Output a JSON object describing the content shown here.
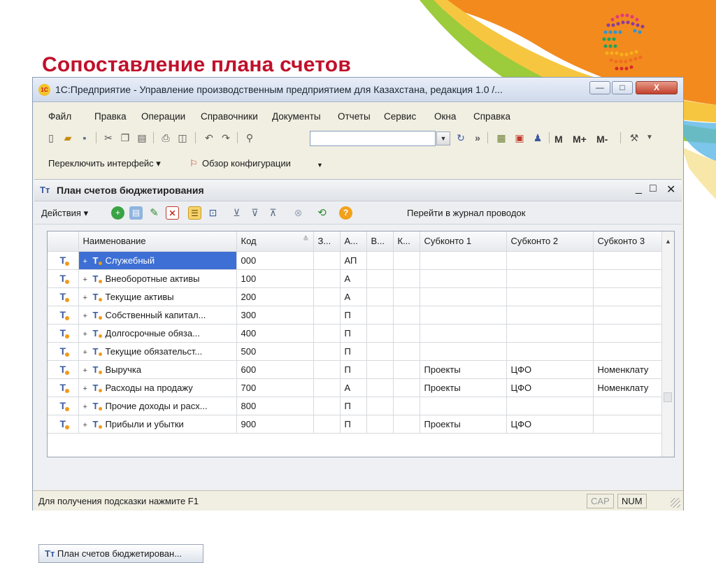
{
  "slide": {
    "title": "Сопоставление плана счетов",
    "accent_color": "#c0102a",
    "logo_icon": "dotted-c-logo-icon"
  },
  "window": {
    "title": "1С:Предприятие - Управление производственным предприятием для Казахстана, редакция 1.0 /...",
    "controls": {
      "minimize": "—",
      "maximize": "□",
      "close": "X"
    }
  },
  "menu": [
    "Файл",
    "Правка",
    "Операции",
    "Справочники",
    "Документы",
    "Отчеты",
    "Сервис",
    "Окна",
    "Справка"
  ],
  "toolbar": {
    "search_value": "",
    "calc_buttons": {
      "m": "M",
      "m_plus": "M+",
      "m_minus": "M-"
    },
    "more": "»"
  },
  "toolbar2": {
    "switch_interface": "Переключить интерфейс ▾",
    "config_overview": "Обзор конфигурации"
  },
  "document": {
    "title": "План счетов бюджетирования",
    "actions_label": "Действия ▾",
    "journal_link": "Перейти в журнал проводок"
  },
  "table": {
    "columns": [
      "",
      "Наименование",
      "Код",
      "З...",
      "А...",
      "В...",
      "К...",
      "Субконто 1",
      "Субконто 2",
      "Субконто 3"
    ],
    "rows": [
      {
        "name": "Служебный",
        "code": "000",
        "z": "",
        "a": "АП",
        "v": "",
        "k": "",
        "s1": "",
        "s2": "",
        "s3": ""
      },
      {
        "name": "Внеоборотные активы",
        "code": "100",
        "z": "",
        "a": "А",
        "v": "",
        "k": "",
        "s1": "",
        "s2": "",
        "s3": ""
      },
      {
        "name": "Текущие активы",
        "code": "200",
        "z": "",
        "a": "А",
        "v": "",
        "k": "",
        "s1": "",
        "s2": "",
        "s3": ""
      },
      {
        "name": "Собственный капитал...",
        "code": "300",
        "z": "",
        "a": "П",
        "v": "",
        "k": "",
        "s1": "",
        "s2": "",
        "s3": ""
      },
      {
        "name": "Долгосрочные обяза...",
        "code": "400",
        "z": "",
        "a": "П",
        "v": "",
        "k": "",
        "s1": "",
        "s2": "",
        "s3": ""
      },
      {
        "name": "Текущие обязательст...",
        "code": "500",
        "z": "",
        "a": "П",
        "v": "",
        "k": "",
        "s1": "",
        "s2": "",
        "s3": ""
      },
      {
        "name": "Выручка",
        "code": "600",
        "z": "",
        "a": "П",
        "v": "",
        "k": "",
        "s1": "Проекты",
        "s2": "ЦФО",
        "s3": "Номенклату"
      },
      {
        "name": "Расходы на продажу",
        "code": "700",
        "z": "",
        "a": "А",
        "v": "",
        "k": "",
        "s1": "Проекты",
        "s2": "ЦФО",
        "s3": "Номенклату"
      },
      {
        "name": "Прочие доходы и расх...",
        "code": "800",
        "z": "",
        "a": "П",
        "v": "",
        "k": "",
        "s1": "",
        "s2": "",
        "s3": ""
      },
      {
        "name": "Прибыли и убытки",
        "code": "900",
        "z": "",
        "a": "П",
        "v": "",
        "k": "",
        "s1": "Проекты",
        "s2": "ЦФО",
        "s3": ""
      }
    ],
    "selected_row": 0
  },
  "taskbar": {
    "tab_label": "План счетов бюджетирован..."
  },
  "status": {
    "hint": "Для получения подсказки нажмите F1",
    "cap": "CAP",
    "num": "NUM"
  }
}
